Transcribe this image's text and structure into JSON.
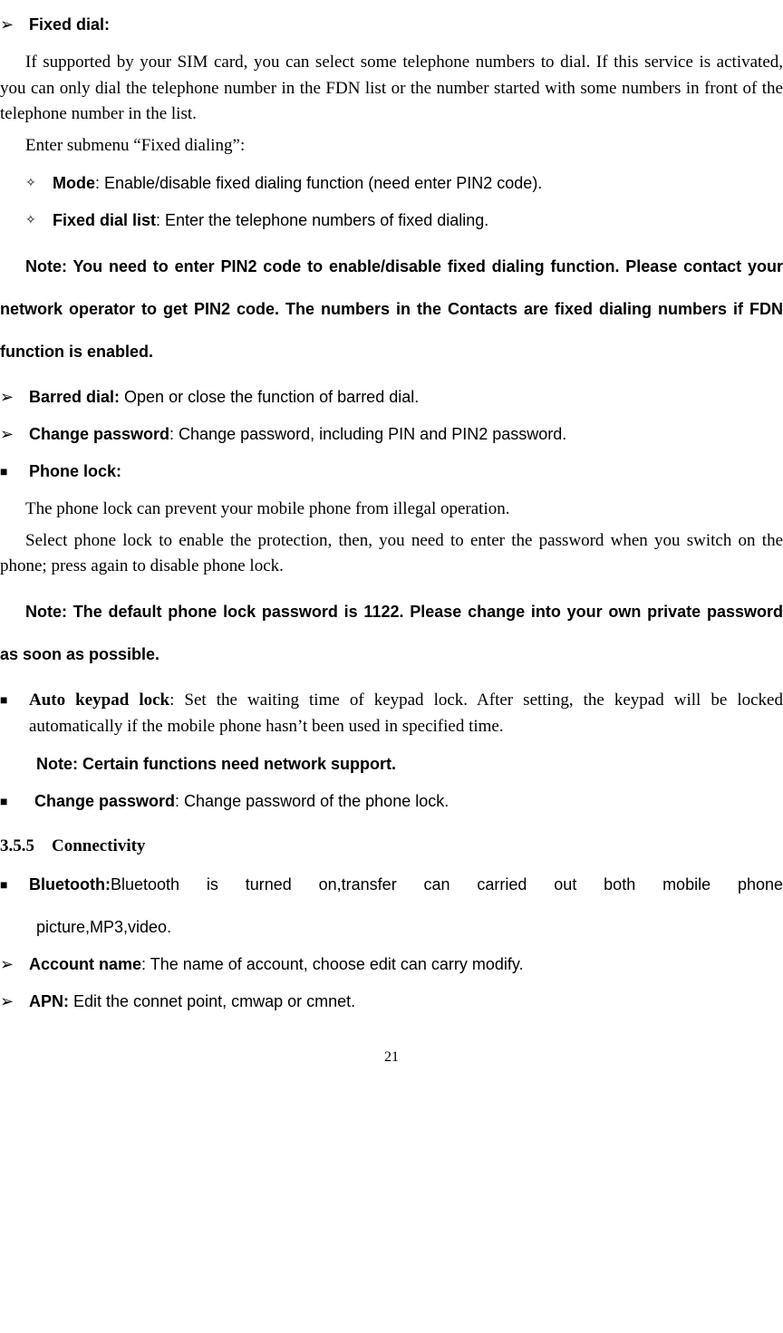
{
  "fixed_dial": {
    "title": "Fixed dial:",
    "p1": "If supported by your SIM card, you can select some telephone numbers to dial. If this service is activated, you can only dial the telephone number in the FDN list or the number started with some numbers in front of the telephone number in the list.",
    "p2_pre": "Enter submenu ",
    "p2_quoted": "“Fixed dialing”",
    "p2_post": ":",
    "mode_label": "Mode",
    "mode_text": ": Enable/disable fixed dialing function (need enter PIN2 code).",
    "list_label": "Fixed dial list",
    "list_text": ": Enter the telephone numbers of fixed dialing.",
    "note": "Note: You need to enter PIN2 code to enable/disable fixed dialing function. Please contact your network operator to get PIN2 code. The numbers in the Contacts are fixed dialing numbers if FDN function is enabled."
  },
  "barred_dial": {
    "label": "Barred dial:",
    "text": " Open or close the function of barred dial."
  },
  "change_pw1": {
    "label": "Change password",
    "text": ": Change password, including PIN and PIN2 password."
  },
  "phone_lock": {
    "title": "Phone lock:",
    "p1": "The phone lock can prevent your mobile phone from illegal operation.",
    "p2": "Select phone lock to enable the protection, then, you need to enter the password when you switch on the phone; press again to disable phone lock.",
    "note": "Note: The default phone lock password is 1122. Please change into your own private password as soon as possible."
  },
  "auto_keypad": {
    "label": "Auto keypad lock",
    "text": ": Set the waiting time of keypad lock. After setting, the keypad will be locked automatically if the mobile phone hasn’t been used in specified time.",
    "note": "Note: Certain functions need network support."
  },
  "change_pw2": {
    "label": "Change password",
    "text": ": Change password of the phone lock."
  },
  "section_355": "3.5.5 Connectivity",
  "bluetooth": {
    "label": "Bluetooth:",
    "text1": "Bluetooth is turned on,transfer can carried out both mobile phone",
    "text2": "picture,MP3,video."
  },
  "account_name": {
    "label": "Account name",
    "text": ": The name of account, choose edit can carry modify."
  },
  "apn": {
    "label": "APN:",
    "text": " Edit the connet point, cmwap or cmnet."
  },
  "page_number": "21",
  "bullets": {
    "arrow": "➢",
    "square": "■",
    "diamond": "✧"
  }
}
